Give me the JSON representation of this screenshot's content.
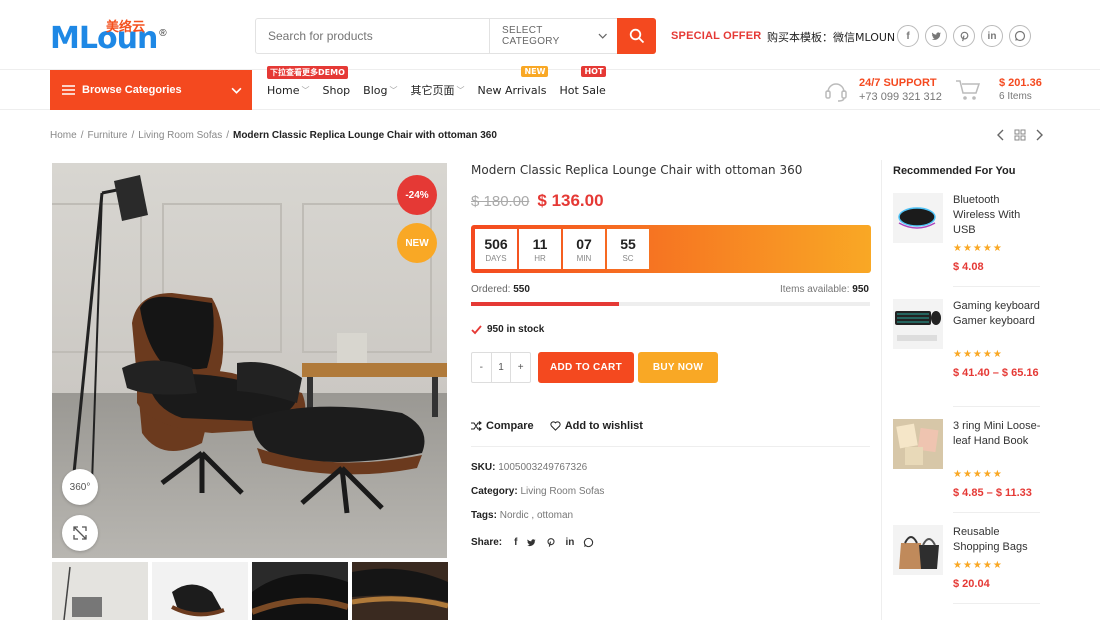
{
  "brand": {
    "logo_text": "MLoun",
    "logo_cn": "美络云",
    "reg": "®"
  },
  "search": {
    "placeholder": "Search for products",
    "category": "SELECT CATEGORY"
  },
  "header": {
    "special_offer": "SPECIAL OFFER",
    "buy_template": "购买本模板：微信MLOUN"
  },
  "socials": [
    "facebook-icon",
    "twitter-icon",
    "pinterest-icon",
    "linkedin-icon",
    "whatsapp-icon"
  ],
  "nav": {
    "browse": "Browse Categories",
    "items": [
      {
        "label": "Home",
        "badge": "下拉查看更多DEMO",
        "dropdown": true
      },
      {
        "label": "Shop"
      },
      {
        "label": "Blog",
        "dropdown": true
      },
      {
        "label": "其它页面",
        "dropdown": true
      },
      {
        "label": "New Arrivals",
        "badge": "NEW"
      },
      {
        "label": "Hot Sale",
        "badge": "HOT"
      }
    ],
    "support_title": "24/7 SUPPORT",
    "support_phone": "+73 099 321 312",
    "cart_total": "$ 201.36",
    "cart_items": "6 Items"
  },
  "breadcrumb": [
    "Home",
    "Furniture",
    "Living Room Sofas",
    "Modern Classic Replica Lounge Chair with ottoman 360"
  ],
  "gallery": {
    "discount": "-24%",
    "new": "NEW",
    "view360": "360°"
  },
  "product": {
    "title": "Modern Classic Replica Lounge Chair with ottoman 360",
    "old_price": "$ 180.00",
    "new_price": "$ 136.00",
    "countdown": [
      {
        "value": "506",
        "unit": "DAYS"
      },
      {
        "value": "11",
        "unit": "HR"
      },
      {
        "value": "07",
        "unit": "MIN"
      },
      {
        "value": "55",
        "unit": "SC"
      }
    ],
    "ordered_label": "Ordered:",
    "ordered": "550",
    "available_label": "Items available:",
    "available": "950",
    "sold_fraction": 0.37,
    "stock": "950 in stock",
    "qty": {
      "minus": "-",
      "value": "1",
      "plus": "+"
    },
    "add_to_cart": "ADD TO CART",
    "buy_now": "BUY NOW",
    "compare": "Compare",
    "wishlist": "Add to wishlist",
    "sku_label": "SKU:",
    "sku": "1005003249767326",
    "category_label": "Category:",
    "category": "Living Room Sofas",
    "tags_label": "Tags:",
    "tags": "Nordic , ottoman",
    "share_label": "Share:"
  },
  "sidebar": {
    "title": "Recommended For You",
    "items": [
      {
        "name": "Bluetooth Wireless With USB",
        "price": "$ 4.08",
        "rating": 5
      },
      {
        "name": "Gaming keyboard Gamer keyboard",
        "price": "$ 41.40 – $ 65.16",
        "rating": 5
      },
      {
        "name": "3 ring Mini Loose-leaf Hand Book",
        "price": "$ 4.85 – $ 11.33",
        "rating": 5
      },
      {
        "name": "Reusable Shopping Bags",
        "price": "$ 20.04",
        "rating": 5
      }
    ]
  },
  "colors": {
    "accent": "#f4491f",
    "secondary": "#f9a825",
    "price": "#e53935",
    "logo": "#1e88e5"
  }
}
